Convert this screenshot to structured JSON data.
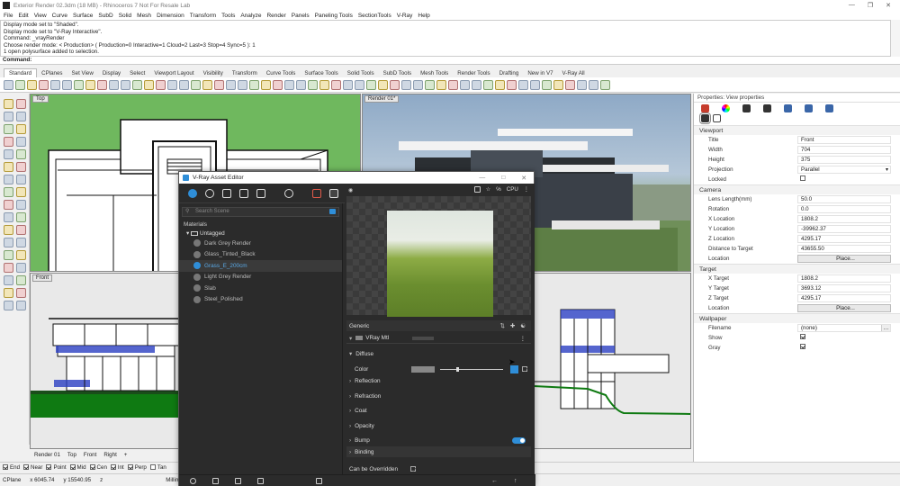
{
  "window": {
    "title": "Exterior Render 02.3dm (18 MB) - Rhinoceros 7 Not For Resale Lab"
  },
  "menu": [
    "File",
    "Edit",
    "View",
    "Curve",
    "Surface",
    "SubD",
    "Solid",
    "Mesh",
    "Dimension",
    "Transform",
    "Tools",
    "Analyze",
    "Render",
    "Panels",
    "Paneling Tools",
    "SectionTools",
    "V-Ray",
    "Help"
  ],
  "command_history": [
    "Display mode set to \"Shaded\".",
    "Display mode set to \"V-Ray Interactive\".",
    "Command: _vrayRender",
    "Choose render mode: < Production> ( Production=0  Interactive=1  Cloud=2  Last=3  Stop=4  Sync=5 ): 1",
    "1 open polysurface added to selection."
  ],
  "command_prompt": "Command:",
  "toolbar_tabs": [
    "Standard",
    "CPlanes",
    "Set View",
    "Display",
    "Select",
    "Viewport Layout",
    "Visibility",
    "Transform",
    "Curve Tools",
    "Surface Tools",
    "Solid Tools",
    "SubD Tools",
    "Mesh Tools",
    "Render Tools",
    "Drafting",
    "New in V7",
    "V-Ray All"
  ],
  "active_toolbar_tab": "Standard",
  "viewports": {
    "top_label": "Top",
    "render_label": "Render 01*",
    "front_label": "Front"
  },
  "view_tabs": [
    "Render 01",
    "Top",
    "Front",
    "Right"
  ],
  "view_tab_add": "+",
  "osnaps": [
    {
      "label": "End",
      "on": true
    },
    {
      "label": "Near",
      "on": true
    },
    {
      "label": "Point",
      "on": true
    },
    {
      "label": "Mid",
      "on": true
    },
    {
      "label": "Cen",
      "on": true
    },
    {
      "label": "Int",
      "on": true
    },
    {
      "label": "Perp",
      "on": true
    },
    {
      "label": "Tan",
      "on": false
    }
  ],
  "status": {
    "cplane": "CPlane",
    "x": "x 6045.74",
    "y": "y 15540.95",
    "z": "z",
    "units": "Millimete"
  },
  "vray": {
    "title": "V-Ray Asset Editor",
    "search_placeholder": "Search Scene",
    "materials_label": "Materials",
    "group": "Untagged",
    "materials": [
      "Dark Grey Render",
      "Glass_Tinted_Black",
      "Grass_E_200cm",
      "Light Grey Render",
      "Slab",
      "Steel_Polished"
    ],
    "selected_material": "Grass_E_200cm",
    "engine": "CPU",
    "generic": "Generic",
    "mtl_name": "VRay Mtl",
    "sections": [
      "Diffuse",
      "Reflection",
      "Refraction",
      "Coat",
      "Opacity",
      "Bump",
      "Binding"
    ],
    "color_label": "Color",
    "can_be_overridden": "Can be Overridden",
    "accent": "#2f8ed8"
  },
  "properties": {
    "header": "Properties: View properties",
    "viewport_section": "Viewport",
    "viewport_rows": [
      {
        "label": "Title",
        "value": "Front",
        "kind": "text"
      },
      {
        "label": "Width",
        "value": "704",
        "kind": "text"
      },
      {
        "label": "Height",
        "value": "375",
        "kind": "text"
      },
      {
        "label": "Projection",
        "value": "Parallel",
        "kind": "dropdown"
      },
      {
        "label": "Locked",
        "value": "",
        "kind": "checkbox",
        "checked": false
      }
    ],
    "camera_section": "Camera",
    "camera_rows": [
      {
        "label": "Lens Length(mm)",
        "value": "50.0",
        "kind": "text"
      },
      {
        "label": "Rotation",
        "value": "0.0",
        "kind": "text"
      },
      {
        "label": "X Location",
        "value": "1808.2",
        "kind": "text"
      },
      {
        "label": "Y Location",
        "value": "-39962.37",
        "kind": "text"
      },
      {
        "label": "Z Location",
        "value": "4295.17",
        "kind": "text"
      },
      {
        "label": "Distance to Target",
        "value": "43655.50",
        "kind": "text"
      },
      {
        "label": "Location",
        "value": "Place...",
        "kind": "button"
      }
    ],
    "target_section": "Target",
    "target_rows": [
      {
        "label": "X Target",
        "value": "1808.2",
        "kind": "text"
      },
      {
        "label": "Y Target",
        "value": "3693.12",
        "kind": "text"
      },
      {
        "label": "Z Target",
        "value": "4295.17",
        "kind": "text"
      },
      {
        "label": "Location",
        "value": "Place...",
        "kind": "button"
      }
    ],
    "wallpaper_section": "Wallpaper",
    "wallpaper_rows": [
      {
        "label": "Filename",
        "value": "(none)",
        "kind": "browse"
      },
      {
        "label": "Show",
        "value": "",
        "kind": "checkbox",
        "checked": true
      },
      {
        "label": "Gray",
        "value": "",
        "kind": "checkbox",
        "checked": true
      }
    ]
  }
}
